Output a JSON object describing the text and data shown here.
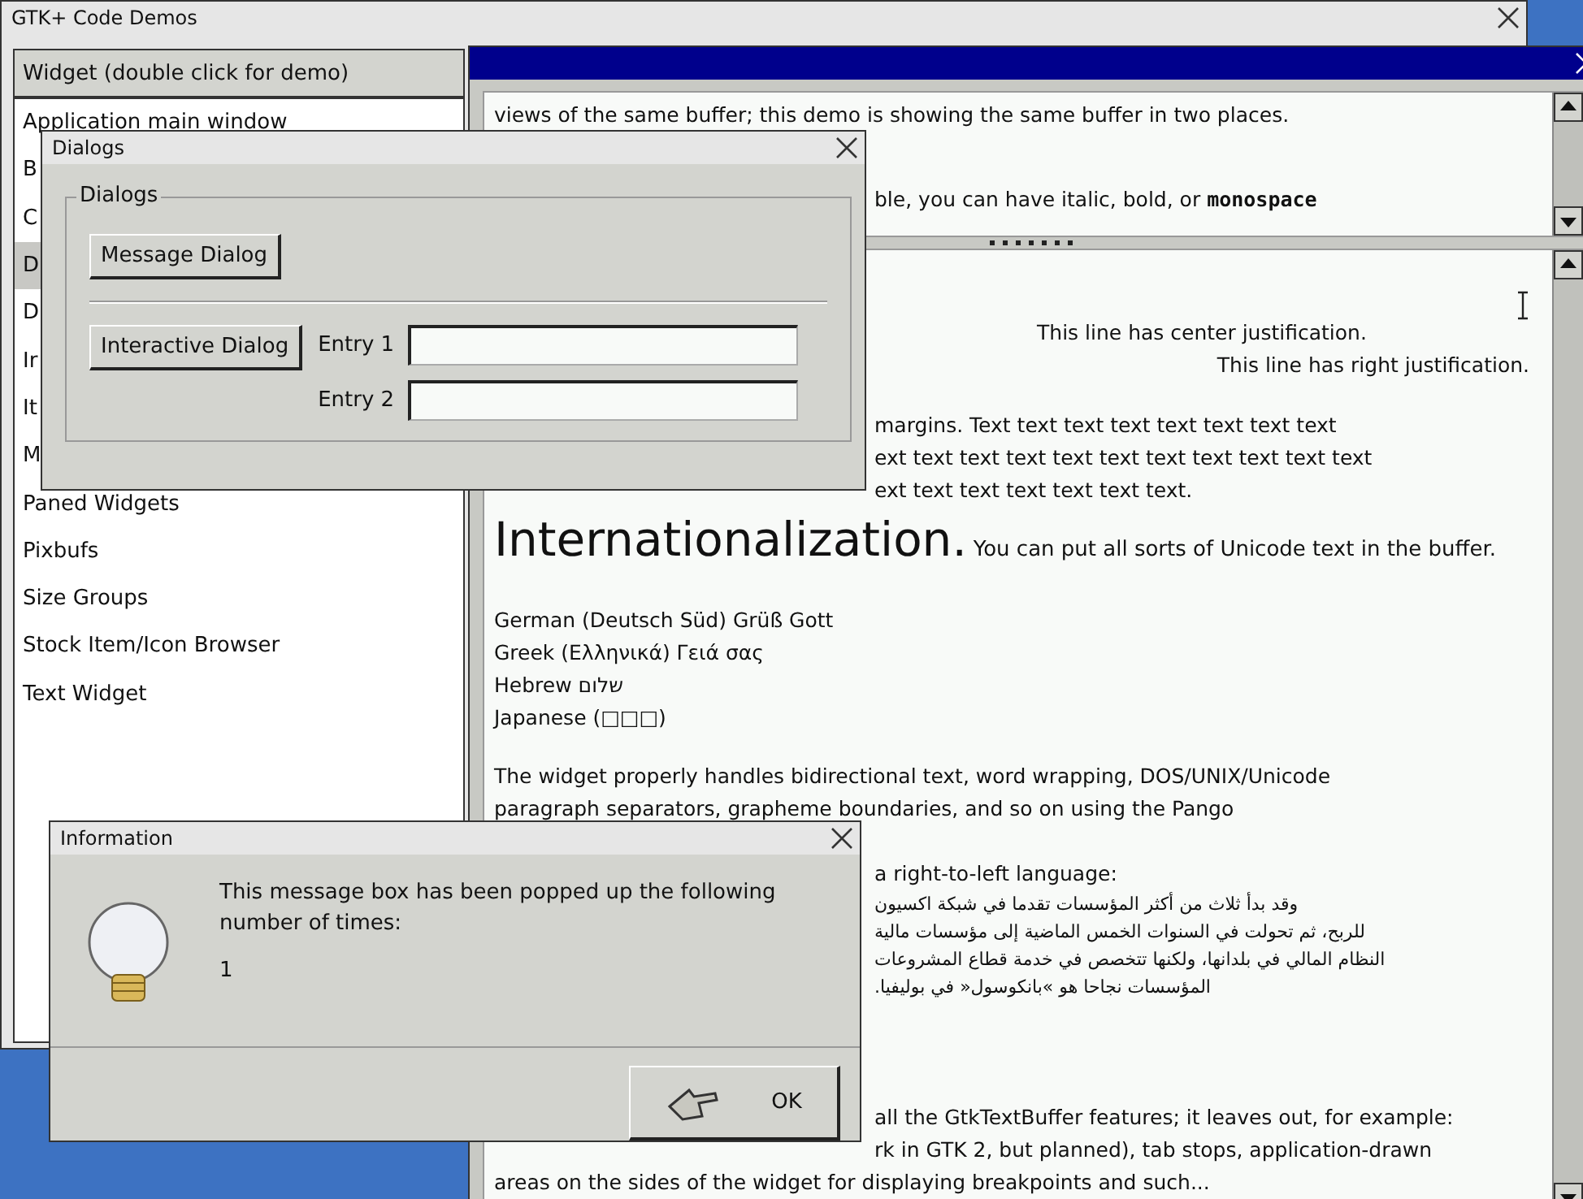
{
  "main_window": {
    "title": "GTK+ Code Demos"
  },
  "demo_list": {
    "header": "Widget (double click for demo)",
    "items": [
      {
        "label": "Application main window",
        "selected": false
      },
      {
        "label": "B",
        "selected": false
      },
      {
        "label": "C",
        "selected": false
      },
      {
        "label": "D",
        "selected": true
      },
      {
        "label": "D",
        "selected": false
      },
      {
        "label": "Ir",
        "selected": false
      },
      {
        "label": "It",
        "selected": false
      },
      {
        "label": "M",
        "selected": false
      },
      {
        "label": "Paned Widgets",
        "selected": false
      },
      {
        "label": "Pixbufs",
        "selected": false
      },
      {
        "label": "Size Groups",
        "selected": false
      },
      {
        "label": "Stock Item/Icon Browser",
        "selected": false
      },
      {
        "label": "Text Widget",
        "selected": false
      }
    ]
  },
  "text_window": {
    "top_pane": [
      {
        "kind": "plain",
        "segments": [
          {
            "kind": "normal",
            "text": "views of the same buffer; this demo is showing the same buffer in two places."
          }
        ]
      },
      {
        "kind": "clipped",
        "segments": [
          {
            "kind": "normal",
            "text": "ble, you can have italic, bold, or "
          },
          {
            "kind": "mono",
            "text": "monospace"
          }
        ]
      }
    ],
    "bottom_pane": [
      {
        "lines": [
          {
            "kind": "center",
            "text": "This line has center justification."
          },
          {
            "kind": "right",
            "text": "This line has right justification."
          }
        ]
      },
      {
        "lines": [
          {
            "kind": "clipped",
            "text": "margins. Text text text text text text text text"
          },
          {
            "kind": "clipped",
            "text": "ext text text text text text text text text text text"
          },
          {
            "kind": "clipped",
            "text": "ext text text text text text text."
          }
        ]
      },
      {
        "lines": [
          {
            "kind": "heading",
            "text": "Internationalization.",
            "rest": "You can put all sorts of Unicode text in the buffer."
          }
        ]
      },
      {
        "lines": [
          {
            "kind": "plain",
            "text": "German (Deutsch Süd) Grüß Gott"
          },
          {
            "kind": "plain",
            "text": "Greek (Ελληνικά) Γειά σας"
          },
          {
            "kind": "plain",
            "text": "Hebrew   שלום"
          },
          {
            "kind": "plain",
            "text": "Japanese (□□□)"
          }
        ]
      },
      {
        "lines": [
          {
            "kind": "plain",
            "text": "The widget properly handles bidirectional text, word wrapping, DOS/UNIX/Unicode"
          },
          {
            "kind": "plain",
            "text": "paragraph separators, grapheme boundaries, and so on using the Pango"
          }
        ]
      },
      {
        "lines": [
          {
            "kind": "clipped",
            "text": "a right-to-left language:"
          },
          {
            "kind": "rtl",
            "text": "وقد بدأ ثلاث من أكثر المؤسسات تقدما في شبكة اكسيون"
          },
          {
            "kind": "rtl",
            "text": "للربح، ثم تحولت في السنوات الخمس الماضية إلى مؤسسات مالية"
          },
          {
            "kind": "rtl",
            "text": "النظام المالي في بلدانها، ولكنها تتخصص في خدمة قطاع المشروعات"
          },
          {
            "kind": "rtl",
            "text": "المؤسسات نجاحا هو »بانكوسول« في بوليفيا."
          }
        ]
      },
      {
        "lines": [
          {
            "kind": "clipped",
            "text": "all the GtkTextBuffer features; it leaves out, for example:"
          },
          {
            "kind": "clipped",
            "text": "rk in GTK 2, but planned), tab stops, application-drawn"
          },
          {
            "kind": "plain",
            "text": "areas on the sides of the widget for displaying breakpoints and such..."
          }
        ]
      }
    ]
  },
  "dialogs_window": {
    "title": "Dialogs",
    "frame_label": "Dialogs",
    "message_button": "Message Dialog",
    "interactive_button": "Interactive Dialog",
    "entries": [
      {
        "label": "Entry 1"
      },
      {
        "label": "Entry 2"
      }
    ]
  },
  "information_window": {
    "title": "Information",
    "message": "This message box has been popped up the following number of times:",
    "count": "1",
    "ok_button": "OK"
  }
}
